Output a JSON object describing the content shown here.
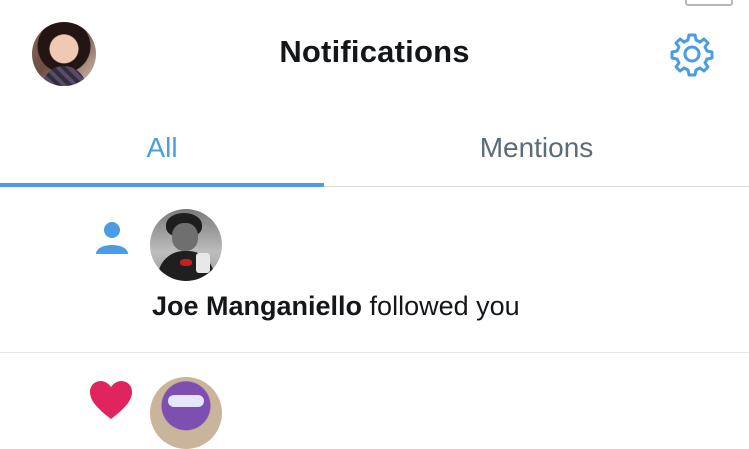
{
  "header": {
    "title": "Notifications",
    "profile_avatar": "profile-avatar",
    "settings_icon": "gear-icon"
  },
  "tabs": [
    {
      "label": "All",
      "selected": true
    },
    {
      "label": "Mentions",
      "selected": false
    }
  ],
  "notifications": [
    {
      "type_icon": "person-icon",
      "user_name": "Joe Manganiello",
      "action": " followed you"
    },
    {
      "type_icon": "heart-icon"
    }
  ],
  "colors": {
    "accent": "#4a9de5",
    "like": "#e0245e",
    "secondary_text": "#5b6b7b",
    "divider": "#d8dde1"
  }
}
